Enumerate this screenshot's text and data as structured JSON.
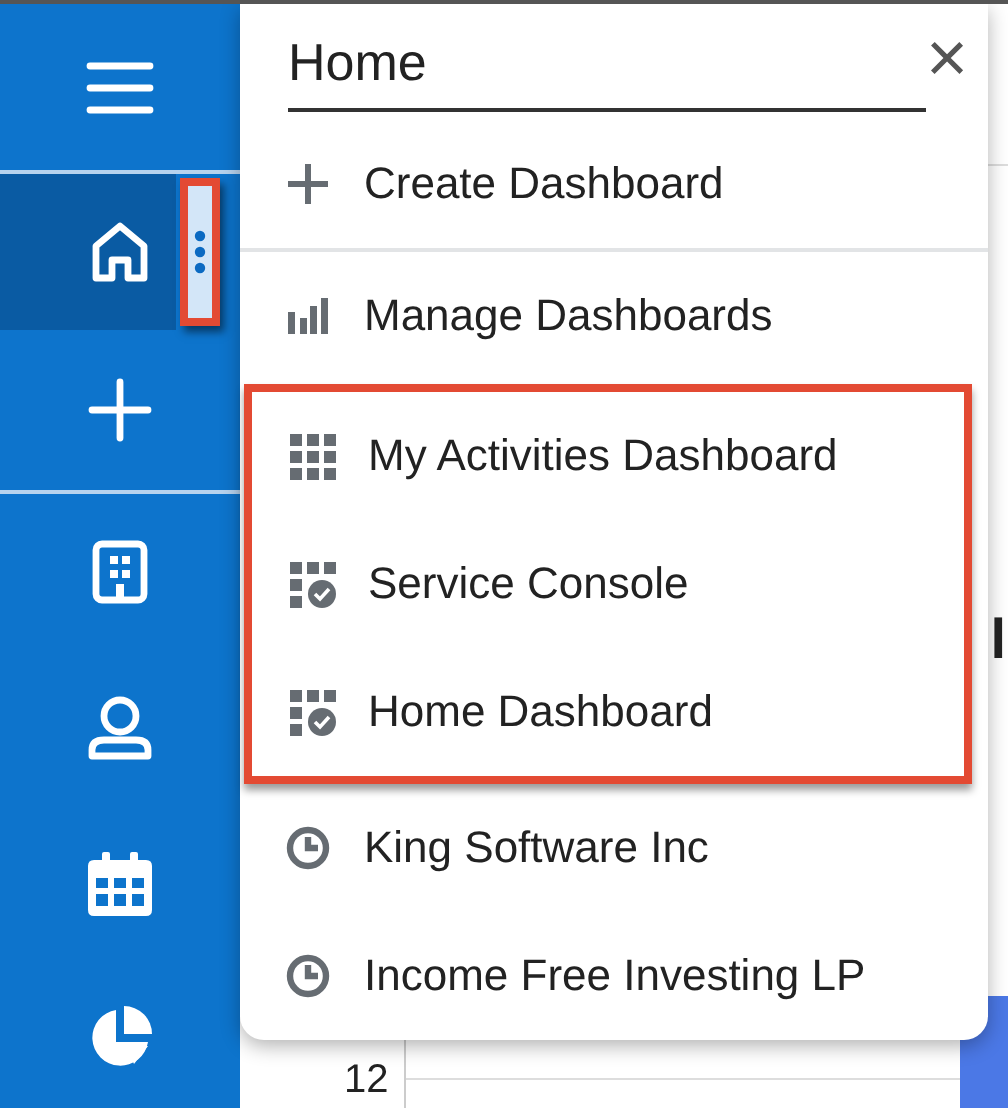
{
  "sidebar": {
    "items": [
      {
        "kind": "menu",
        "selected": false
      },
      {
        "kind": "home",
        "selected": true,
        "handle": {
          "highlighted": true
        }
      },
      {
        "kind": "plus",
        "selected": false
      },
      {
        "kind": "building",
        "selected": false
      },
      {
        "kind": "person",
        "selected": false
      },
      {
        "kind": "calendar",
        "selected": false
      },
      {
        "kind": "pie",
        "selected": false
      }
    ]
  },
  "background": {
    "heading_fragment": "l",
    "axis_label": "12"
  },
  "menu": {
    "title": "Home",
    "close": "×",
    "sections": [
      {
        "highlighted": false,
        "items": [
          {
            "kind": "add",
            "label": "Create Dashboard"
          }
        ]
      },
      {
        "highlighted": false,
        "items": [
          {
            "kind": "manage",
            "label": "Manage Dashboards"
          }
        ]
      },
      {
        "highlighted": true,
        "items": [
          {
            "kind": "grid",
            "label": "My Activities Dashboard"
          },
          {
            "kind": "grid-check",
            "label": "Service Console"
          },
          {
            "kind": "grid-check",
            "label": "Home Dashboard"
          }
        ]
      },
      {
        "highlighted": false,
        "items": [
          {
            "kind": "recent",
            "label": "King Software Inc"
          },
          {
            "kind": "recent",
            "label": "Income Free Investing LP"
          }
        ]
      }
    ]
  }
}
